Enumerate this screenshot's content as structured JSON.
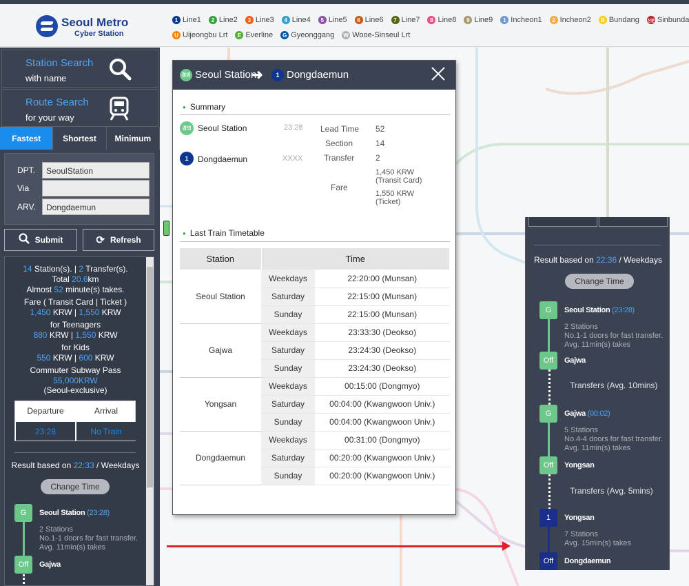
{
  "brand": {
    "title": "Seoul Metro",
    "subtitle": "Cyber Station"
  },
  "lines_row1": [
    {
      "badge": "1",
      "label": "Line1",
      "color": "#0d3692"
    },
    {
      "badge": "2",
      "label": "Line2",
      "color": "#33a23d"
    },
    {
      "badge": "3",
      "label": "Line3",
      "color": "#fe5b10"
    },
    {
      "badge": "4",
      "label": "Line4",
      "color": "#32a1c8"
    },
    {
      "badge": "5",
      "label": "Line5",
      "color": "#8b50a4"
    },
    {
      "badge": "6",
      "label": "Line6",
      "color": "#c55c1d"
    },
    {
      "badge": "7",
      "label": "Line7",
      "color": "#54640d"
    },
    {
      "badge": "8",
      "label": "Line8",
      "color": "#f14c82"
    },
    {
      "badge": "9",
      "label": "Line9",
      "color": "#aa9872"
    },
    {
      "badge": "1",
      "label": "Incheon1",
      "color": "#6f99d0"
    },
    {
      "badge": "2",
      "label": "Incheon2",
      "color": "#f4ab3e"
    },
    {
      "badge": "B",
      "label": "Bundang",
      "color": "#ffcd12"
    },
    {
      "badge": "신분",
      "label": "Sinbunda",
      "color": "#c6172b"
    }
  ],
  "lines_row2": [
    {
      "badge": "U",
      "label": "Uijeongbu Lrt",
      "color": "#fd8100"
    },
    {
      "badge": "E",
      "label": "Everline",
      "color": "#56ad2d"
    },
    {
      "badge": "G",
      "label": "Gyeonggang",
      "color": "#0054a6"
    },
    {
      "badge": "W",
      "label": "Wooe-Sinseul Lrt",
      "color": "#b0b0b0"
    }
  ],
  "left": {
    "station_search": {
      "title": "Station Search",
      "sub": "with name"
    },
    "route_search": {
      "title": "Route Search",
      "sub": "for your way"
    },
    "tabs": [
      "Fastest",
      "Shortest",
      "Minimum"
    ],
    "form": {
      "dpt_label": "DPT.",
      "dpt_value": "SeoulStation",
      "via_label": "Via",
      "via_value": "",
      "arv_label": "ARV.",
      "arv_value": "Dongdaemun"
    },
    "submit": "Submit",
    "refresh": "Refresh",
    "summary": {
      "stations": "14",
      "stations_txt": " Station(s). | ",
      "transfers": "2",
      "transfers_txt": " Transfer(s).",
      "total_pre": "Total ",
      "total": "20.6",
      "total_unit": "km",
      "almost_pre": "Almost ",
      "almost": "52",
      "almost_post": " minute(s) takes.",
      "fare_label": "Fare ( Transit Card | Ticket )",
      "fare_card": "1,450",
      "fare_ticket": "1,550",
      "teen_label": "for Teenagers",
      "teen_card": "880",
      "teen_ticket": "1,550",
      "kids_label": "for Kids",
      "kids_card": "550",
      "kids_ticket": "600",
      "pass_label": "Commuter Subway Pass",
      "pass_value": "55,000KRW",
      "pass_note": "(Seoul-exclusive)",
      "krw": "KRW",
      "sep": " | "
    },
    "deparr": {
      "dep_label": "Departure",
      "arr_label": "Arrival",
      "dep_value": "23:28",
      "arr_value": "No Train"
    },
    "result_pre": "Result based on ",
    "result_time": "22:33",
    "result_post": " / Weekdays",
    "change_time": "Change Time",
    "route": [
      {
        "badge": "G",
        "name": "Seoul Station",
        "time": "(23:28)",
        "sub1": "2 Stations",
        "sub2": "No.1-1 doors for fast transfer.",
        "sub3": "Avg. 11min(s) takes"
      },
      {
        "badge": "Off",
        "name": "Gajwa"
      }
    ]
  },
  "popup": {
    "from_badge": "경의",
    "from": "Seoul Station",
    "to_badge": "1",
    "to": "Dongdaemun",
    "summary_title": "Summary",
    "row1_name": "Seoul Station",
    "row1_time": "23:28",
    "row2_name": "Dongdaemun",
    "row2_time": "XXXX",
    "lead_label": "Lead Time",
    "lead_value": "52",
    "section_label": "Section",
    "section_value": "14",
    "transfer_label": "Transfer",
    "transfer_value": "2",
    "fare_label": "Fare",
    "fare1": "1,450 KRW",
    "fare1_sub": "(Transit Card)",
    "fare2": "1,550 KRW",
    "fare2_sub": "(Ticket)",
    "timetable_title": "Last Train Timetable",
    "col_station": "Station",
    "col_time": "Time",
    "rows": [
      {
        "station": "Seoul Station",
        "times": [
          [
            "Weekdays",
            "22:20:00 (Munsan)"
          ],
          [
            "Saturday",
            "22:15:00 (Munsan)"
          ],
          [
            "Sunday",
            "22:15:00 (Munsan)"
          ]
        ]
      },
      {
        "station": "Gajwa",
        "times": [
          [
            "Weekdays",
            "23:33:30 (Deokso)"
          ],
          [
            "Saturday",
            "23:24:30 (Deokso)"
          ],
          [
            "Sunday",
            "23:24:30 (Deokso)"
          ]
        ]
      },
      {
        "station": "Yongsan",
        "times": [
          [
            "Weekdays",
            "00:15:00 (Dongmyo)"
          ],
          [
            "Saturday",
            "00:04:00 (Kwangwoon Univ.)"
          ],
          [
            "Sunday",
            "00:04:00 (Kwangwoon Univ.)"
          ]
        ]
      },
      {
        "station": "Dongdaemun",
        "times": [
          [
            "Weekdays",
            "00:31:00 (Dongmyo)"
          ],
          [
            "Saturday",
            "00:20:00 (Kwangwoon Univ.)"
          ],
          [
            "Sunday",
            "00:20:00 (Kwangwoon Univ.)"
          ]
        ]
      }
    ]
  },
  "right": {
    "result_pre": "Result based on ",
    "result_time": "22:36",
    "result_post": " / Weekdays",
    "change_time": "Change Time",
    "route": [
      {
        "badge": "G",
        "name": "Seoul Station",
        "time": "(23:28)",
        "sub1": "2 Stations",
        "sub2": "No.1-1 doors for fast transfer.",
        "sub3": "Avg. 11min(s) takes"
      },
      {
        "badge": "Off",
        "name": "Gajwa"
      },
      {
        "transfer": "Transfers (Avg. 10mins)"
      },
      {
        "badge": "G",
        "name": "Gajwa",
        "time": "(00:02)",
        "sub1": "5 Stations",
        "sub2": "No.4-4 doors for fast transfer.",
        "sub3": "Avg. 11min(s) takes"
      },
      {
        "badge": "Off",
        "name": "Yongsan"
      },
      {
        "transfer": "Transfers (Avg. 5mins)"
      },
      {
        "badge": "1",
        "name": "Yongsan",
        "sub1": "7 Stations",
        "sub3": "Avg. 15min(s) takes"
      },
      {
        "badge": "Off",
        "name": "Dongdaemun"
      }
    ]
  }
}
